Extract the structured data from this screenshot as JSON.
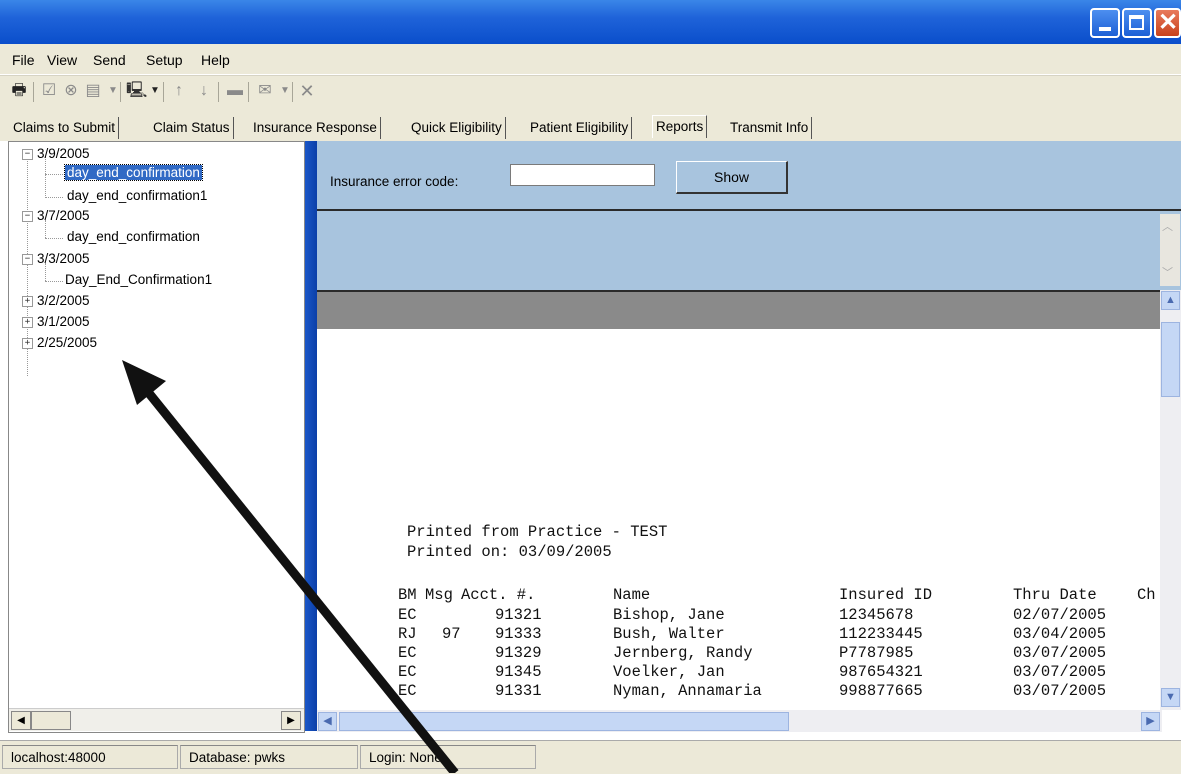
{
  "menu": [
    "File",
    "View",
    "Send",
    "Setup",
    "Help"
  ],
  "tabs": [
    "Claims to Submit",
    "Claim Status",
    "Insurance Response",
    "Quick Eligibility",
    "Patient Eligibility",
    "Reports",
    "Transmit Info"
  ],
  "active_tab": "Reports",
  "tree": [
    {
      "label": "3/9/2005",
      "expanded": true,
      "children": [
        "day_end_confirmation",
        "day_end_confirmation1"
      ]
    },
    {
      "label": "3/7/2005",
      "expanded": true,
      "children": [
        "day_end_confirmation"
      ]
    },
    {
      "label": "3/3/2005",
      "expanded": true,
      "children": [
        "Day_End_Confirmation1"
      ]
    },
    {
      "label": "3/2/2005",
      "expanded": false,
      "children": []
    },
    {
      "label": "3/1/2005",
      "expanded": false,
      "children": []
    },
    {
      "label": "2/25/2005",
      "expanded": false,
      "children": []
    }
  ],
  "selected_item": "day_end_confirmation",
  "error_code": {
    "label": "Insurance error code:",
    "value": "",
    "button": "Show"
  },
  "report": {
    "printed_from": "Printed from Practice - TEST",
    "printed_on": "Printed on: 03/09/2005",
    "columns": [
      "BM",
      "Msg",
      "Acct. #.",
      "Name",
      "Insured ID",
      "Thru Date",
      "Ch"
    ],
    "rows": [
      {
        "bm": "EC",
        "msg": "",
        "acct": "91321",
        "name": "Bishop, Jane",
        "insured": "12345678",
        "thru": "02/07/2005"
      },
      {
        "bm": "RJ",
        "msg": "97",
        "acct": "91333",
        "name": "Bush, Walter",
        "insured": "112233445",
        "thru": "03/04/2005"
      },
      {
        "bm": "EC",
        "msg": "",
        "acct": "91329",
        "name": "Jernberg, Randy",
        "insured": "P7787985",
        "thru": "03/07/2005"
      },
      {
        "bm": "EC",
        "msg": "",
        "acct": "91345",
        "name": "Voelker, Jan",
        "insured": "987654321",
        "thru": "03/07/2005"
      },
      {
        "bm": "EC",
        "msg": "",
        "acct": "91331",
        "name": "Nyman, Annamaria",
        "insured": "998877665",
        "thru": "03/07/2005"
      }
    ]
  },
  "status": {
    "host": "localhost:48000",
    "database": "Database: pwks",
    "login": "Login: None"
  },
  "colors": {
    "title": "#0a4ecb",
    "panel": "#a8c4de",
    "selection": "#316ac5",
    "arrow": "#111111"
  }
}
